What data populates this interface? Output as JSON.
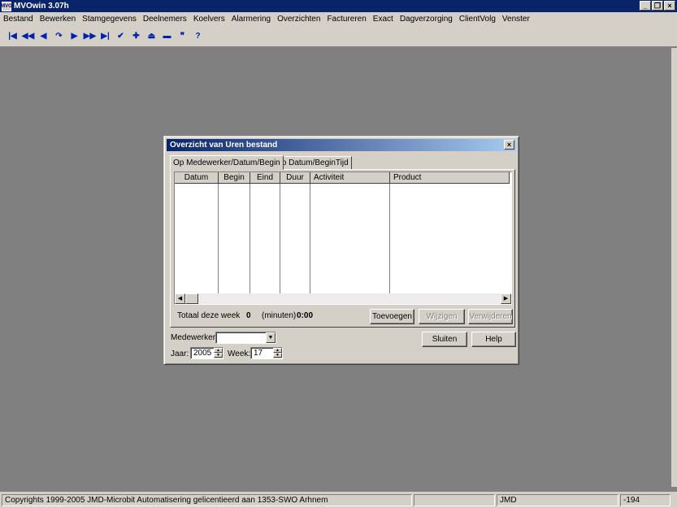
{
  "app": {
    "title": "MVOwin 3.07h",
    "icon_text": "MVO"
  },
  "window_controls": {
    "minimize": "_",
    "restore": "❐",
    "close": "×"
  },
  "menu": [
    {
      "label": "Bestand"
    },
    {
      "label": "Bewerken"
    },
    {
      "label": "Stamgegevens"
    },
    {
      "label": "Deelnemers"
    },
    {
      "label": "Koelvers"
    },
    {
      "label": "Alarmering"
    },
    {
      "label": "Overzichten"
    },
    {
      "label": "Factureren"
    },
    {
      "label": "Exact"
    },
    {
      "label": "Dagverzorging"
    },
    {
      "label": "ClientVolg"
    },
    {
      "label": "Venster"
    }
  ],
  "toolbar": [
    {
      "icon": "first-record-icon",
      "glyph": "|◀"
    },
    {
      "icon": "rewind-icon",
      "glyph": "◀◀"
    },
    {
      "icon": "previous-icon",
      "glyph": "◀"
    },
    {
      "icon": "refresh-icon",
      "glyph": "↷"
    },
    {
      "icon": "next-icon",
      "glyph": "▶"
    },
    {
      "icon": "fast-forward-icon",
      "glyph": "▶▶"
    },
    {
      "icon": "last-record-icon",
      "glyph": "▶|"
    },
    {
      "icon": "check-icon",
      "glyph": "✔"
    },
    {
      "icon": "plus-icon",
      "glyph": "✚"
    },
    {
      "icon": "eject-icon",
      "glyph": "⏏"
    },
    {
      "icon": "minus-icon",
      "glyph": "▬"
    },
    {
      "icon": "quote-icon",
      "glyph": "❞"
    },
    {
      "icon": "help-icon",
      "glyph": "?"
    }
  ],
  "dialog": {
    "title": "Overzicht van Uren bestand",
    "close": "×",
    "tabs": [
      {
        "label": "Op Medewerker/Datum/Begin"
      },
      {
        "label": "Op Datum/BeginTijd"
      }
    ],
    "columns": [
      {
        "label": "Datum"
      },
      {
        "label": "Begin"
      },
      {
        "label": "Eind"
      },
      {
        "label": "Duur"
      },
      {
        "label": "Activiteit"
      },
      {
        "label": "Product"
      }
    ],
    "total_label": "Totaal deze week",
    "total_count": "0",
    "minutes_label": "(minuten)",
    "minutes_value": "0:00",
    "buttons": {
      "add": "Toevoegen",
      "edit": "Wijzigen",
      "delete": "Verwijderen",
      "close": "Sluiten",
      "help": "Help"
    },
    "medewerker_label": "Medewerker:",
    "medewerker_value": "",
    "jaar_label": "Jaar:",
    "jaar_value": "2005",
    "week_label": "Week:",
    "week_value": "17"
  },
  "status": {
    "copyright": "Copyrights 1999-2005 JMD-Microbit Automatisering gelicentieerd aan 1353-SWO Arhnem",
    "panel2": "",
    "user": "JMD",
    "code": "-194"
  }
}
